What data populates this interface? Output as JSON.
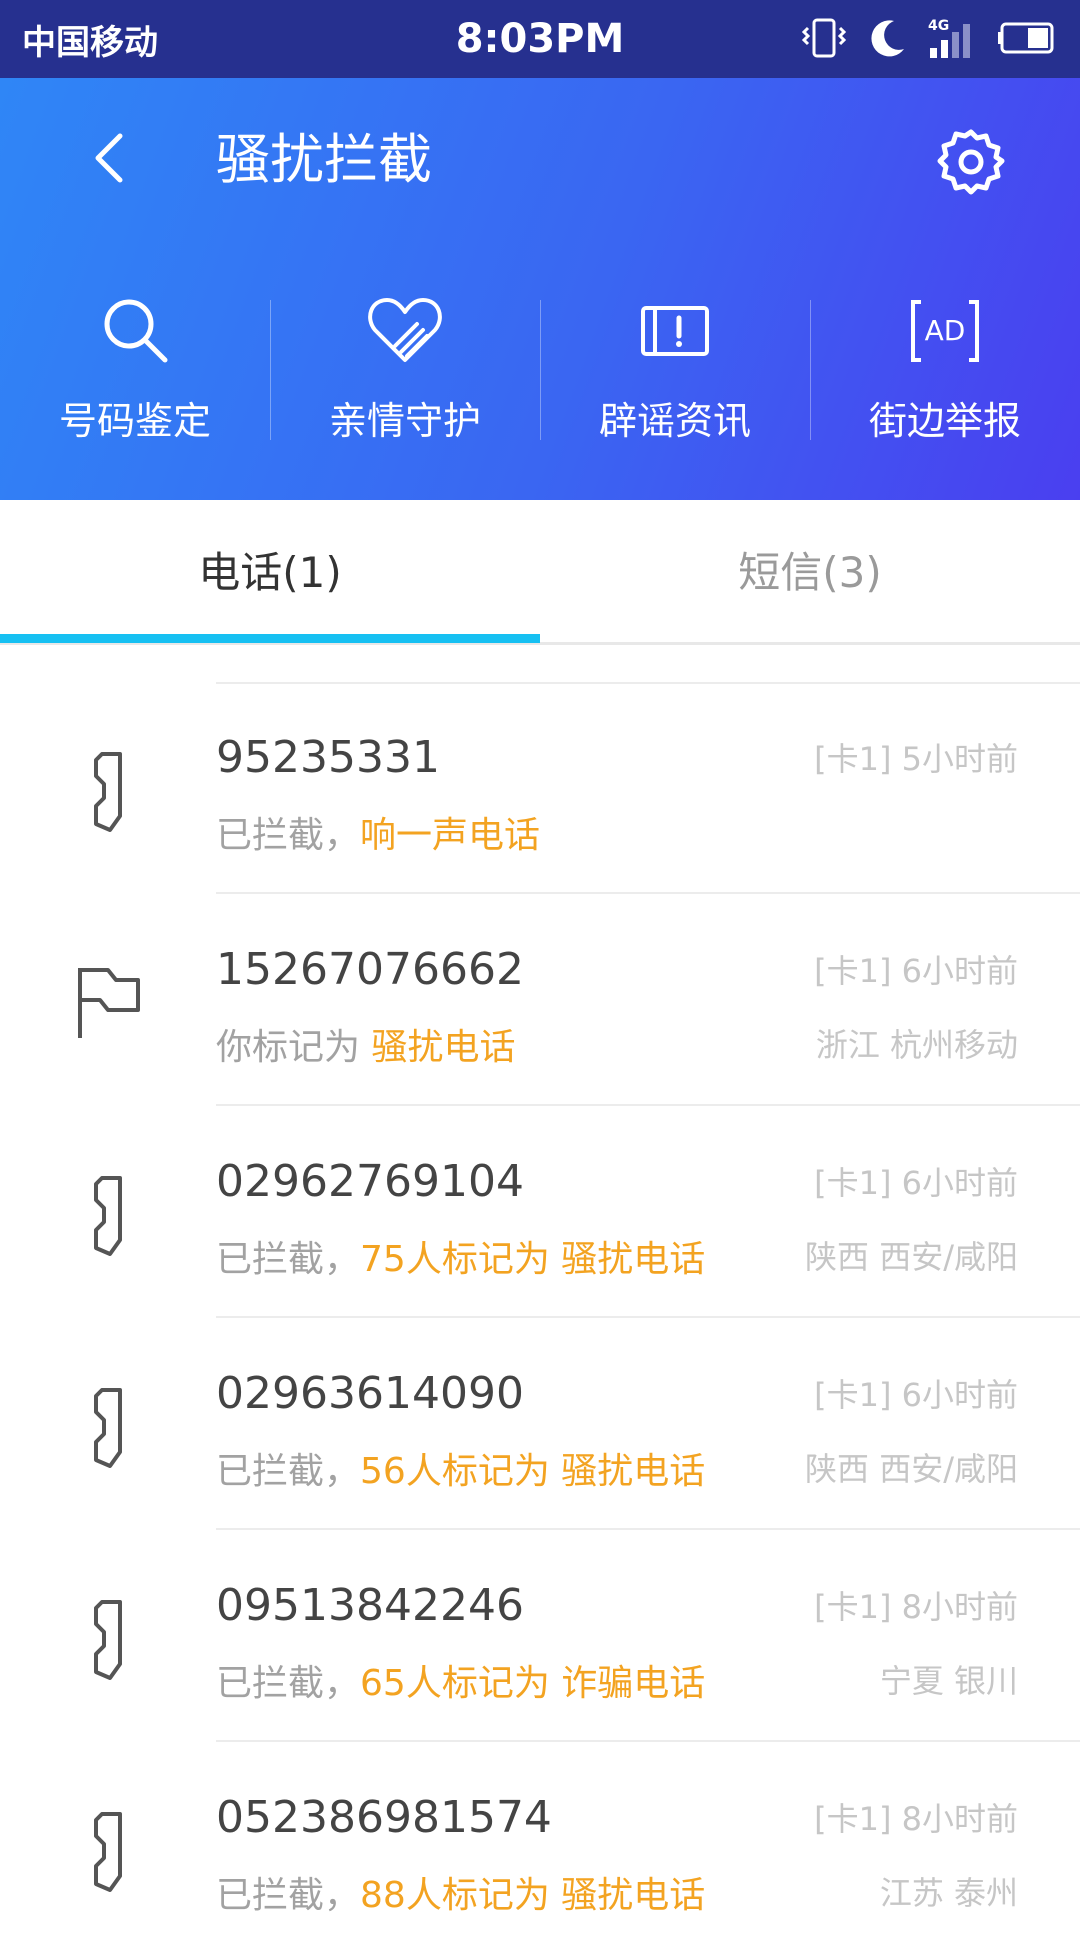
{
  "status_bar": {
    "carrier": "中国移动",
    "time": "8:03PM",
    "network_label": "4G"
  },
  "header": {
    "title": "骚扰拦截",
    "features": [
      {
        "label": "号码鉴定",
        "icon": "search-icon"
      },
      {
        "label": "亲情守护",
        "icon": "heart-hands-icon"
      },
      {
        "label": "辟谣资讯",
        "icon": "alert-paper-icon"
      },
      {
        "label": "街边举报",
        "icon": "ad-icon"
      }
    ]
  },
  "tabs": [
    {
      "label": "电话(1)",
      "active": true
    },
    {
      "label": "短信(3)",
      "active": false
    }
  ],
  "calls": [
    {
      "number": "95235331",
      "meta": "[卡1] 5小时前",
      "prefix": "已拦截，",
      "highlight": "响一声电话",
      "location": "",
      "icon": "blocked-phone-icon"
    },
    {
      "number": "15267076662",
      "meta": "[卡1] 6小时前",
      "prefix": "你标记为 ",
      "highlight": "骚扰电话",
      "location": "浙江 杭州移动",
      "icon": "flag-icon"
    },
    {
      "number": "02962769104",
      "meta": "[卡1] 6小时前",
      "prefix": "已拦截，",
      "highlight": "75人标记为 骚扰电话",
      "location": "陕西 西安/咸阳",
      "icon": "blocked-phone-icon"
    },
    {
      "number": "02963614090",
      "meta": "[卡1] 6小时前",
      "prefix": "已拦截，",
      "highlight": "56人标记为 骚扰电话",
      "location": "陕西 西安/咸阳",
      "icon": "blocked-phone-icon"
    },
    {
      "number": "09513842246",
      "meta": "[卡1] 8小时前",
      "prefix": "已拦截，",
      "highlight": "65人标记为 诈骗电话",
      "location": "宁夏 银川",
      "icon": "blocked-phone-icon"
    },
    {
      "number": "052386981574",
      "meta": "[卡1] 8小时前",
      "prefix": "已拦截，",
      "highlight": "88人标记为 骚扰电话",
      "location": "江苏 泰州",
      "icon": "blocked-phone-icon"
    }
  ],
  "colors": {
    "status_bar": "#26308f",
    "header_start": "#2f86f6",
    "header_end": "#4a3ff0",
    "tab_indicator": "#16c0f2",
    "highlight": "#f3a321"
  }
}
